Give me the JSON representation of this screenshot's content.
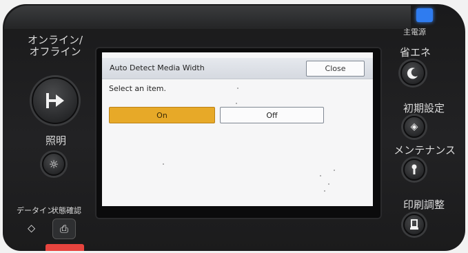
{
  "panel": {
    "left": {
      "online_label": "オンライン/\nオフライン",
      "light_label": "照明",
      "data_in_label": "データイン",
      "status_label": "状態確認"
    },
    "right": {
      "main_power_label": "主電源",
      "energy_saver_label": "省エネ",
      "initial_settings_label": "初期設定",
      "maintenance_label": "メンテナンス",
      "print_adjust_label": "印刷調整"
    },
    "colors": {
      "power_led": "#2f7cf0",
      "status_led": "#e7443e"
    }
  },
  "screen": {
    "title": "Auto Detect Media Width",
    "close_label": "Close",
    "prompt": "Select an item.",
    "options": [
      {
        "label": "On",
        "selected": true
      },
      {
        "label": "Off",
        "selected": false
      }
    ],
    "colors": {
      "selected": "#e7a928",
      "titlebar": "#dde0e6"
    }
  },
  "icons": {
    "online": "arrow-right-to-bar-icon",
    "light": "sun-icon",
    "data_in": "diamond-arrow-icon",
    "status": "document-check-icon",
    "energy_saver": "crescent-moon-icon",
    "initial_settings": "diamond-gear-icon",
    "maintenance": "wrench-icon",
    "print_adjust": "print-adjust-icon"
  }
}
